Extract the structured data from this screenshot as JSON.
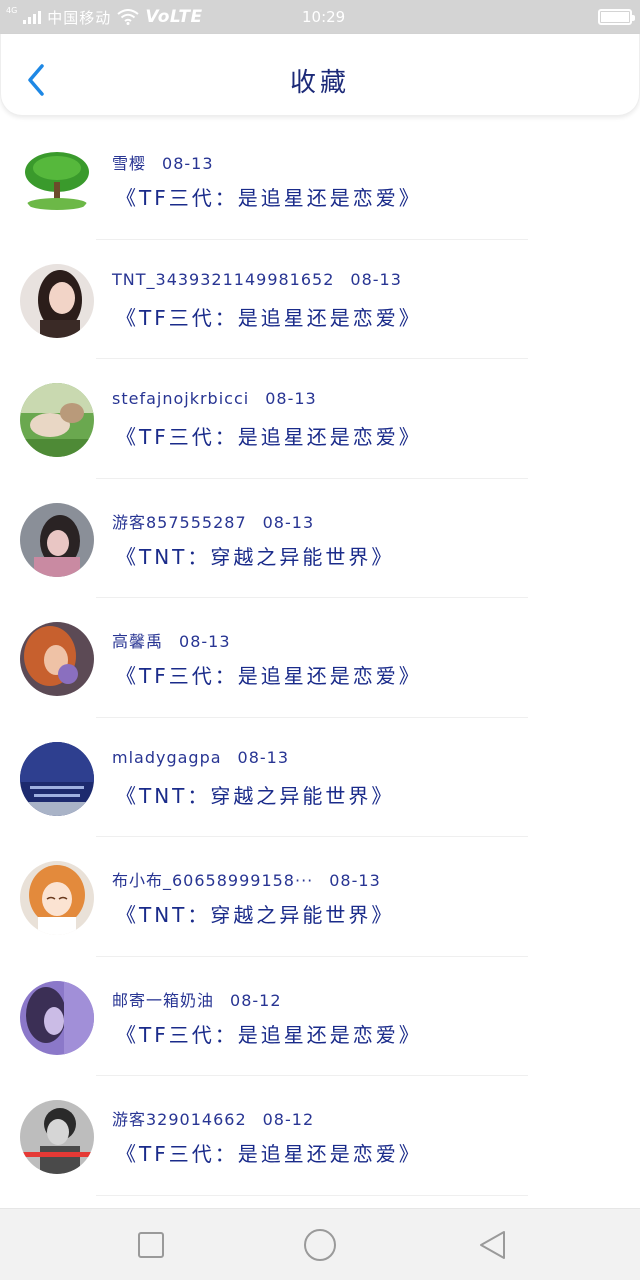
{
  "status_bar": {
    "network_type": "4G",
    "carrier": "中国移动",
    "volte": "VoLTE",
    "time": "10:29"
  },
  "header": {
    "title": "收藏"
  },
  "colors": {
    "accent": "#1e88e5",
    "title_text": "#1c2a78",
    "item_text": "#283593"
  },
  "items": [
    {
      "user": "雪樱",
      "date": "08-13",
      "program": "《TF三代：是追星还是恋爱》",
      "avatar": "tree-avatar"
    },
    {
      "user": "TNT_343932114998​1652",
      "date": "08-13",
      "program": "《TF三代：是追星还是恋爱》",
      "avatar": "girl-portrait-avatar"
    },
    {
      "user": "stefajnojkrbicci",
      "date": "08-13",
      "program": "《TF三代：是追星还是恋爱》",
      "avatar": "nature-photo-avatar"
    },
    {
      "user": "游客857555287",
      "date": "08-13",
      "program": "《TNT：穿越之异能世界》",
      "avatar": "girl-hat-avatar"
    },
    {
      "user": "高馨禹",
      "date": "08-13",
      "program": "《TF三代：是追星还是恋爱》",
      "avatar": "girl-flower-avatar"
    },
    {
      "user": "mladygagpa",
      "date": "08-13",
      "program": "《TNT：穿越之异能世界》",
      "avatar": "night-sky-text-avatar"
    },
    {
      "user": "布小布_60658999158···",
      "date": "08-13",
      "program": "《TNT：穿越之异能世界》",
      "avatar": "anime-girl-avatar"
    },
    {
      "user": "邮寄一箱奶油",
      "date": "08-12",
      "program": "《TF三代：是追星还是恋爱》",
      "avatar": "purple-portrait-avatar"
    },
    {
      "user": "游客329014662",
      "date": "08-12",
      "program": "《TF三代：是追星还是恋爱》",
      "avatar": "bw-portrait-avatar"
    }
  ],
  "nav_bar": {
    "recent": "square-icon",
    "home": "circle-icon",
    "back": "triangle-back-icon"
  }
}
